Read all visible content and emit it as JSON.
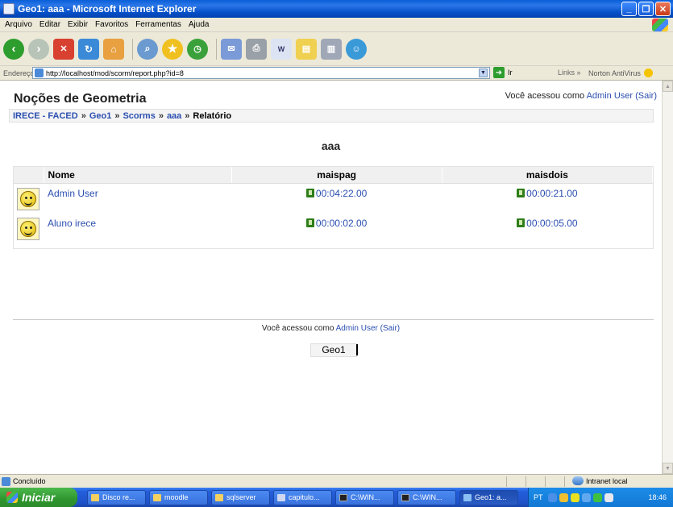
{
  "window": {
    "title": "Geo1: aaa - Microsoft Internet Explorer"
  },
  "menu": [
    "Arquivo",
    "Editar",
    "Exibir",
    "Favoritos",
    "Ferramentas",
    "Ajuda"
  ],
  "address": {
    "label": "Endereço",
    "url": "http://localhost/mod/scorm/report.php?id=8",
    "go_label": "Ir",
    "links_label": "Links",
    "norton_label": "Norton AntiVirus"
  },
  "page": {
    "site_title": "Noções de Geometria",
    "login": {
      "prefix": "Você acessou como",
      "user": "Admin User",
      "logout": "(Sair)"
    },
    "breadcrumb": {
      "items": [
        "IRECE - FACED",
        "Geo1",
        "Scorms",
        "aaa"
      ],
      "current": "Relatório"
    },
    "heading": "aaa",
    "table": {
      "headers": [
        "Nome",
        "maispag",
        "maisdois"
      ],
      "rows": [
        {
          "name": "Admin User",
          "maispag": "00:04:22.00",
          "maisdois": "00:00:21.00"
        },
        {
          "name": "Aluno irece",
          "maispag": "00:00:02.00",
          "maisdois": "00:00:05.00"
        }
      ]
    },
    "footer": {
      "login_prefix": "Você acessou como",
      "login_user": "Admin User",
      "login_logout": "(Sair)",
      "course": "Geo1"
    }
  },
  "status": {
    "text": "Concluído",
    "zone": "Intranet local"
  },
  "taskbar": {
    "start_label": "Iniciar",
    "buttons": [
      "Disco re...",
      "moodle",
      "sqlserver",
      "capitulo...",
      "C:\\WIN...",
      "C:\\WIN...",
      "Geo1: a..."
    ],
    "lang": "PT",
    "clock": "18:46"
  },
  "colors": {
    "link": "#2b4fb0",
    "titlebar": "#0a5fd8",
    "taskbar": "#245edb",
    "start": "#2f962f"
  }
}
